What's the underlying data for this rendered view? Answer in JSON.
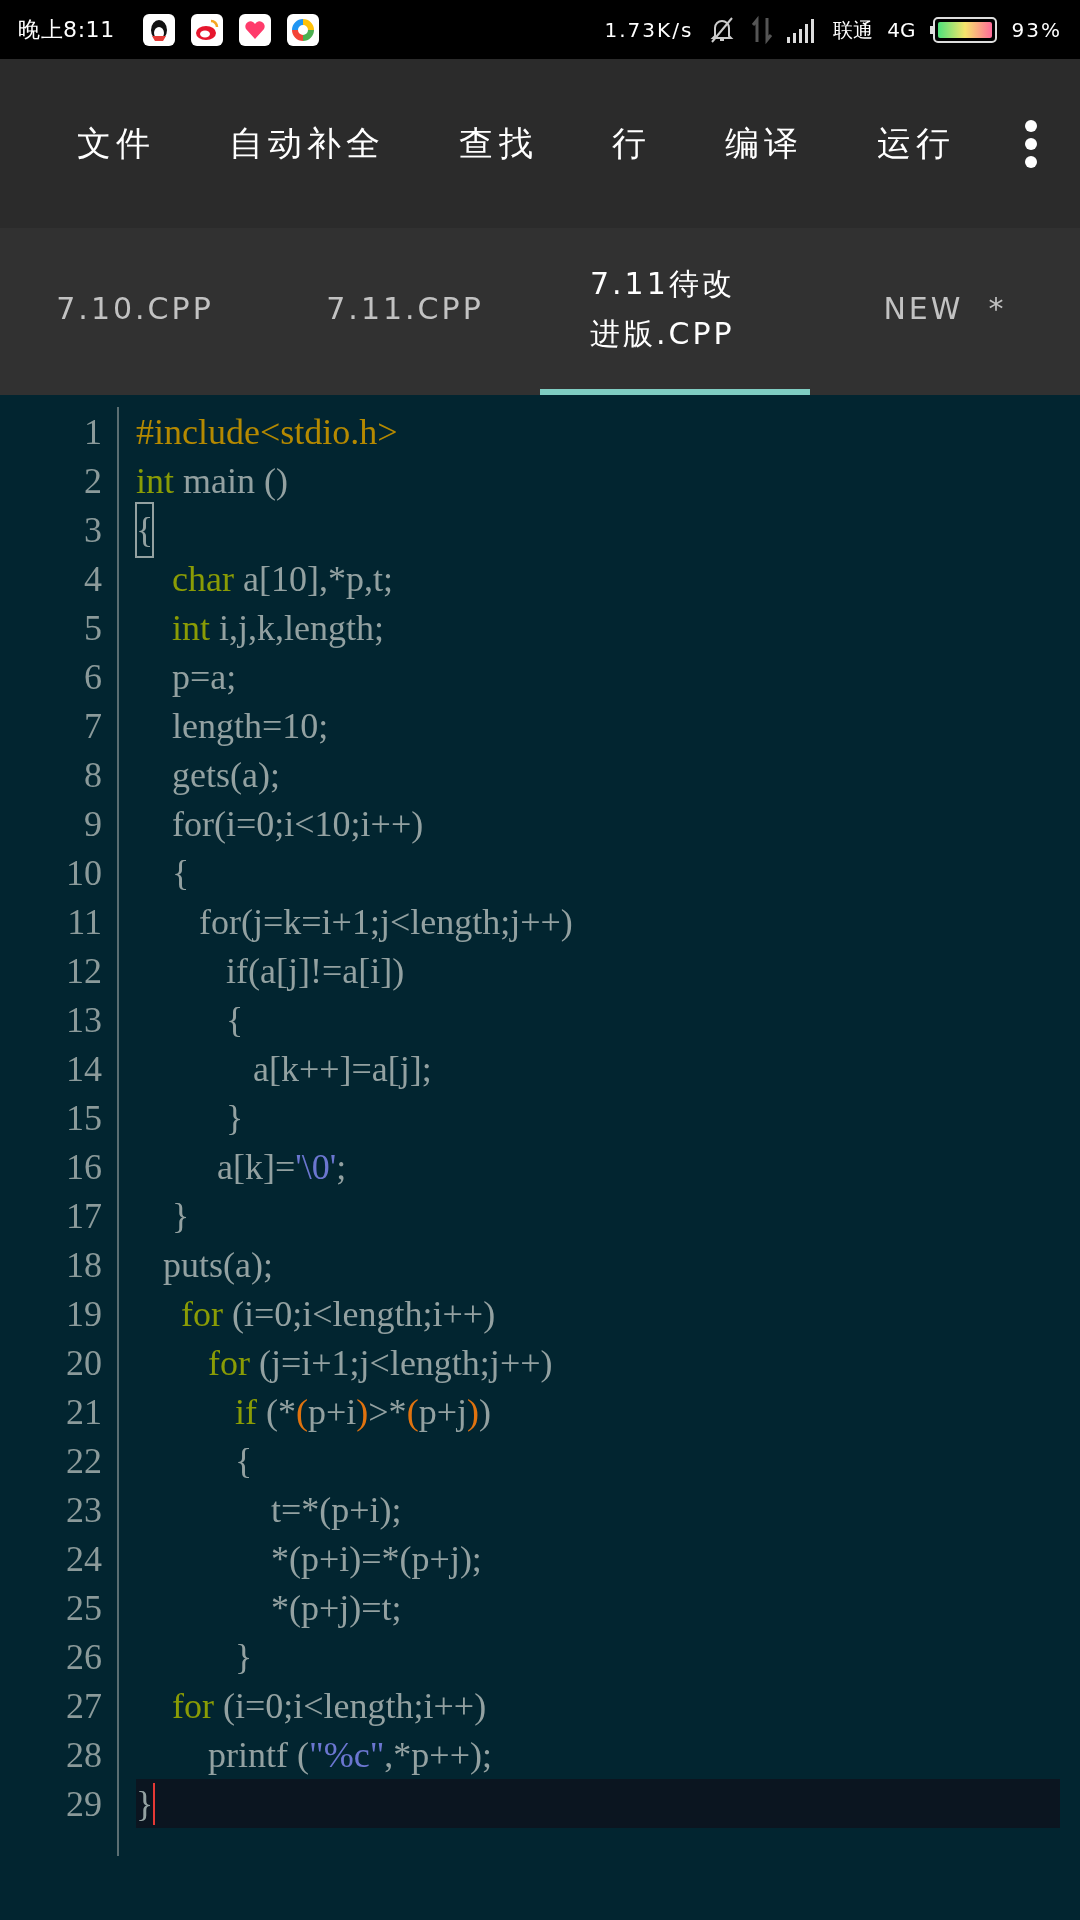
{
  "status_bar": {
    "time": "晚上8:11",
    "speed": "1.73K/s",
    "carrier": "联通",
    "network": "4G",
    "battery": "93%"
  },
  "menu": [
    {
      "label": "文件"
    },
    {
      "label": "自动补全"
    },
    {
      "label": "查找"
    },
    {
      "label": "行"
    },
    {
      "label": "编译"
    },
    {
      "label": "运行"
    }
  ],
  "tabs": [
    {
      "label": "7.10.CPP",
      "selected": false
    },
    {
      "label": "7.11.CPP",
      "selected": false
    },
    {
      "label": "7.11待改进版.CPP",
      "selected": true
    },
    {
      "label": "NEW  *",
      "selected": false
    }
  ],
  "code_lines": [
    {
      "number": "1",
      "current": false,
      "tokens": [
        {
          "kind": "preproc",
          "text": "#include<stdio.h>"
        }
      ]
    },
    {
      "number": "2",
      "current": false,
      "tokens": [
        {
          "kind": "keyword",
          "text": "int"
        },
        {
          "kind": "plain",
          "text": " main ()"
        }
      ]
    },
    {
      "number": "3",
      "current": false,
      "tokens": [
        {
          "kind": "match",
          "text": "{"
        }
      ]
    },
    {
      "number": "4",
      "current": false,
      "tokens": [
        {
          "kind": "keyword",
          "text": "    char"
        },
        {
          "kind": "plain",
          "text": " a[10],*p,t;"
        }
      ]
    },
    {
      "number": "5",
      "current": false,
      "tokens": [
        {
          "kind": "keyword",
          "text": "    int"
        },
        {
          "kind": "plain",
          "text": " i,j,k,length;"
        }
      ]
    },
    {
      "number": "6",
      "current": false,
      "tokens": [
        {
          "kind": "plain",
          "text": "    p=a;"
        }
      ]
    },
    {
      "number": "7",
      "current": false,
      "tokens": [
        {
          "kind": "plain",
          "text": "    length=10;"
        }
      ]
    },
    {
      "number": "8",
      "current": false,
      "tokens": [
        {
          "kind": "plain",
          "text": "    gets(a);"
        }
      ]
    },
    {
      "number": "9",
      "current": false,
      "tokens": [
        {
          "kind": "plain",
          "text": "    for(i=0;i<10;i++)"
        }
      ]
    },
    {
      "number": "10",
      "current": false,
      "tokens": [
        {
          "kind": "plain",
          "text": "    {"
        }
      ]
    },
    {
      "number": "11",
      "current": false,
      "tokens": [
        {
          "kind": "plain",
          "text": "       for(j=k=i+1;j<length;j++)"
        }
      ]
    },
    {
      "number": "12",
      "current": false,
      "tokens": [
        {
          "kind": "plain",
          "text": "          if(a[j]!=a[i])"
        }
      ]
    },
    {
      "number": "13",
      "current": false,
      "tokens": [
        {
          "kind": "plain",
          "text": "          {"
        }
      ]
    },
    {
      "number": "14",
      "current": false,
      "tokens": [
        {
          "kind": "plain",
          "text": "             a[k++]=a[j];"
        }
      ]
    },
    {
      "number": "15",
      "current": false,
      "tokens": [
        {
          "kind": "plain",
          "text": "          }"
        }
      ]
    },
    {
      "number": "16",
      "current": false,
      "tokens": [
        {
          "kind": "plain",
          "text": "         a[k]="
        },
        {
          "kind": "string",
          "text": "'\\0'"
        },
        {
          "kind": "plain",
          "text": ";"
        }
      ]
    },
    {
      "number": "17",
      "current": false,
      "tokens": [
        {
          "kind": "plain",
          "text": "    }"
        }
      ]
    },
    {
      "number": "18",
      "current": false,
      "tokens": [
        {
          "kind": "plain",
          "text": "   puts(a);"
        }
      ]
    },
    {
      "number": "19",
      "current": false,
      "tokens": [
        {
          "kind": "keyword",
          "text": "     for"
        },
        {
          "kind": "plain",
          "text": " (i=0;i<length;i++)"
        }
      ]
    },
    {
      "number": "20",
      "current": false,
      "tokens": [
        {
          "kind": "keyword",
          "text": "        for"
        },
        {
          "kind": "plain",
          "text": " (j=i+1;j<length;j++)"
        }
      ]
    },
    {
      "number": "21",
      "current": false,
      "tokens": [
        {
          "kind": "keyword",
          "text": "           if"
        },
        {
          "kind": "plain",
          "text": " (*"
        },
        {
          "kind": "paren",
          "text": "("
        },
        {
          "kind": "plain",
          "text": "p+i"
        },
        {
          "kind": "paren",
          "text": ")"
        },
        {
          "kind": "plain",
          "text": ">*"
        },
        {
          "kind": "paren",
          "text": "("
        },
        {
          "kind": "plain",
          "text": "p+j"
        },
        {
          "kind": "paren",
          "text": ")"
        },
        {
          "kind": "plain",
          "text": ")"
        }
      ]
    },
    {
      "number": "22",
      "current": false,
      "tokens": [
        {
          "kind": "plain",
          "text": "           {"
        }
      ]
    },
    {
      "number": "23",
      "current": false,
      "tokens": [
        {
          "kind": "plain",
          "text": "               t=*(p+i);"
        }
      ]
    },
    {
      "number": "24",
      "current": false,
      "tokens": [
        {
          "kind": "plain",
          "text": "               *(p+i)=*(p+j);"
        }
      ]
    },
    {
      "number": "25",
      "current": false,
      "tokens": [
        {
          "kind": "plain",
          "text": "               *(p+j)=t;"
        }
      ]
    },
    {
      "number": "26",
      "current": false,
      "tokens": [
        {
          "kind": "plain",
          "text": "           }"
        }
      ]
    },
    {
      "number": "27",
      "current": false,
      "tokens": [
        {
          "kind": "keyword",
          "text": "    for"
        },
        {
          "kind": "plain",
          "text": " (i=0;i<length;i++)"
        }
      ]
    },
    {
      "number": "28",
      "current": false,
      "tokens": [
        {
          "kind": "plain",
          "text": "        printf ("
        },
        {
          "kind": "string",
          "text": "\"%c\""
        },
        {
          "kind": "plain",
          "text": ",*p++);"
        }
      ]
    },
    {
      "number": "29",
      "current": true,
      "tokens": [
        {
          "kind": "plain",
          "text": "}"
        }
      ]
    }
  ]
}
